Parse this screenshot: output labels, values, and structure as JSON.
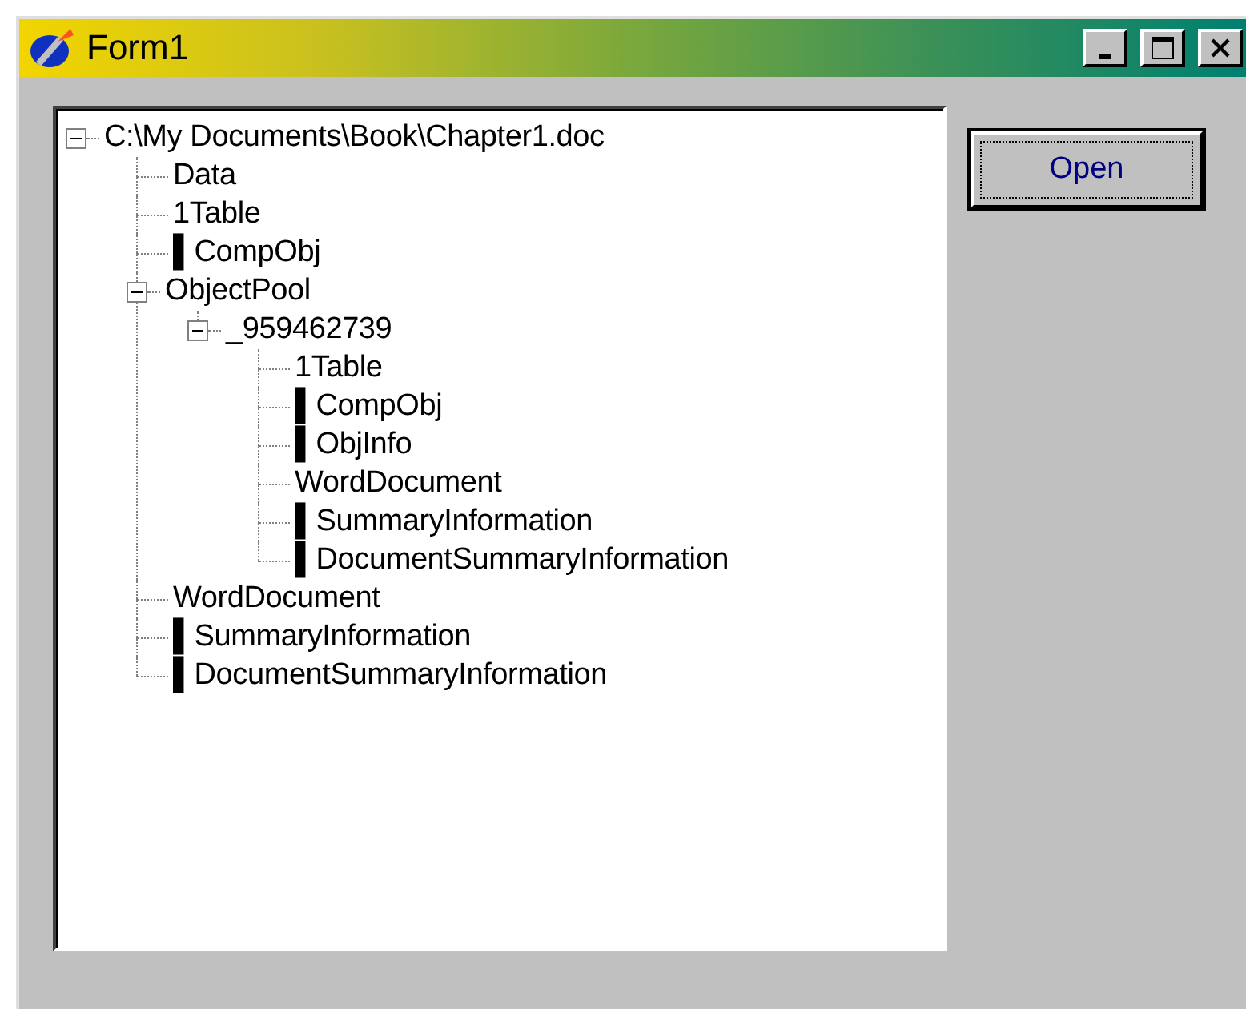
{
  "window": {
    "title": "Form1",
    "controls": [
      {
        "kind": "minimize"
      },
      {
        "kind": "maximize"
      },
      {
        "kind": "close"
      }
    ]
  },
  "tree": [
    {
      "label": "C:\\My Documents\\Book\\Chapter1.doc",
      "expanded": true,
      "children": [
        {
          "label": "Data"
        },
        {
          "label": "1Table"
        },
        {
          "label": "▌CompObj"
        },
        {
          "label": "ObjectPool",
          "expanded": true,
          "children": [
            {
              "label": "_959462739",
              "expanded": true,
              "children": [
                {
                  "label": "1Table"
                },
                {
                  "label": "▌CompObj"
                },
                {
                  "label": "▌ObjInfo"
                },
                {
                  "label": "WordDocument"
                },
                {
                  "label": "▌SummaryInformation"
                },
                {
                  "label": "▌DocumentSummaryInformation"
                }
              ]
            }
          ]
        },
        {
          "label": "WordDocument"
        },
        {
          "label": "▌SummaryInformation"
        },
        {
          "label": "▌DocumentSummaryInformation"
        }
      ]
    }
  ],
  "button": {
    "label": "Open",
    "focused": true
  }
}
